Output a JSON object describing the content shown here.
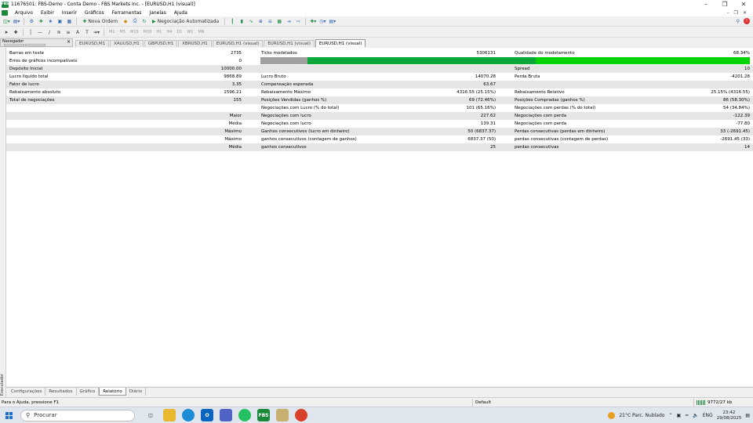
{
  "window": {
    "title": "11676501: FBS-Demo - Conta Demo - FBS Markets Inc. - [EURUSD,H1 (visual)]",
    "app_badge": "FBS"
  },
  "menu": {
    "items": [
      "Arquivo",
      "Exibir",
      "Inserir",
      "Gráficos",
      "Ferramentas",
      "Janelas",
      "Ajuda"
    ]
  },
  "toolbar": {
    "new_order": "Nova Ordem",
    "auto_trading": "Negociação Automatizada",
    "timeframes": [
      "M1",
      "M5",
      "M15",
      "M30",
      "H1",
      "H4",
      "D1",
      "W1",
      "MN"
    ]
  },
  "navigator": {
    "title": "Navegador"
  },
  "chart_tabs": [
    {
      "label": "EURUSD,M1",
      "active": false
    },
    {
      "label": "XAUUSD,H1",
      "active": false
    },
    {
      "label": "GBPUSD,H1",
      "active": false
    },
    {
      "label": "XBRUSD,H1",
      "active": false
    },
    {
      "label": "EURUSD,H1 (visual)",
      "active": false
    },
    {
      "label": "EURUSD,H1 (visual)",
      "active": false
    },
    {
      "label": "EURUSD,H1 (visual)",
      "active": true
    }
  ],
  "report": {
    "bars_label": "Barras em teste",
    "bars_value": "2735",
    "ticks_label": "Ticks modelados",
    "ticks_value": "5306131",
    "quality_label": "Qualidade do modelamento",
    "quality_value": "68.34%",
    "errors_label": "Erros de gráficos incompatíveis",
    "errors_value": "0",
    "deposit_label": "Depósito Inicial",
    "deposit_value": "10000.00",
    "spread_label": "Spread",
    "spread_value": "10",
    "net_label": "Lucro líquido total",
    "net_value": "9868.89",
    "gross_profit_label": "Lucro Bruto",
    "gross_profit_value": "14070.28",
    "gross_loss_label": "Perda Bruta",
    "gross_loss_value": "-4201.28",
    "pf_label": "Fator de lucro",
    "pf_value": "3.35",
    "payoff_label": "Compensação esperada",
    "payoff_value": "63.67",
    "abs_dd_label": "Rebaixamento absoluto",
    "abs_dd_value": "1596.21",
    "max_dd_label": "Rebaixamento Máximo",
    "max_dd_value": "4316.55 (25.15%)",
    "rel_dd_label": "Rebaixamento Relativo",
    "rel_dd_value": "25.15% (4316.55)",
    "trades_label": "Total de negociações",
    "trades_value": "155",
    "short_label": "Posições Vendidas (ganhos %)",
    "short_value": "69 (72.46%)",
    "long_label": "Posições Compradas (ganhos %)",
    "long_value": "86 (58.30%)",
    "profit_trades_label": "Negociações com Lucro (% do total)",
    "profit_trades_value": "101 (65.16%)",
    "loss_trades_label": "Negociações com perdas (% do total)",
    "loss_trades_value": "54 (34.84%)",
    "largest_label": "Maior",
    "largest_profit_label": "Negociações com lucro",
    "largest_profit_value": "227.62",
    "largest_loss_label": "Negociações com perda",
    "largest_loss_value": "-122.39",
    "average_label": "Média",
    "average_profit_label": "Negociações com lucro",
    "average_profit_value": "139.31",
    "average_loss_label": "Negociações com perda",
    "average_loss_value": "-77.80",
    "maximum_label": "Máximo",
    "max_consec_wins_label": "Ganhos consecutivos (lucro em dinheiro)",
    "max_consec_wins_value": "50 (6837.37)",
    "max_consec_losses_label": "Perdas consecutivas (perdas em dinheiro)",
    "max_consec_losses_value": "33 (-2691.45)",
    "maximal_label": "Máximo",
    "maximal_wins_label": "ganhos consecutivos (contagem de ganhos)",
    "maximal_wins_value": "6837.37 (50)",
    "maximal_losses_label": "perdas consecutivas (contagem de perdas)",
    "maximal_losses_value": "-2691.45 (33)",
    "avg_consec_label": "Média",
    "avg_consec_wins_label": "ganhos consecutivos",
    "avg_consec_wins_value": "25",
    "avg_consec_losses_label": "perdas consecutivas",
    "avg_consec_losses_value": "14"
  },
  "bottom_tabs": [
    {
      "label": "Configurações",
      "active": false
    },
    {
      "label": "Resultados",
      "active": false
    },
    {
      "label": "Gráfico",
      "active": false
    },
    {
      "label": "Relatório",
      "active": true
    },
    {
      "label": "Diário",
      "active": false
    }
  ],
  "side_label": "Executador",
  "status": {
    "help": "Para o Ajuda, pressione F1",
    "profile": "Default",
    "traffic": "9772/27 kb"
  },
  "taskbar": {
    "search_placeholder": "Procurar",
    "weather": "21°C  Parc. Nublado",
    "lang": "ENG",
    "time": "23:42",
    "date": "29/08/2025"
  },
  "colors": {
    "quality_gray": "#a0a0a0",
    "quality_dark_green": "#08a838",
    "quality_green": "#00d400",
    "brand_green": "#1a8a3a"
  }
}
